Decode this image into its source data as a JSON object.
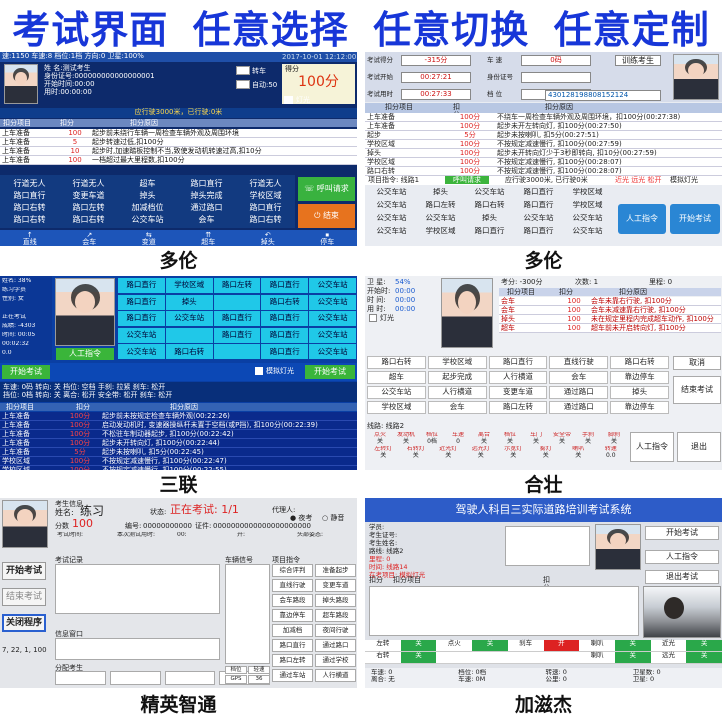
{
  "banner": {
    "parts": [
      "考试界面",
      "任意选择",
      "任意切换",
      "任意定制"
    ]
  },
  "captions": {
    "p1": "多伦",
    "p2": "多伦",
    "p3": "三联",
    "p4": "合壮",
    "p5": "精英智通",
    "p6": "加滋杰"
  },
  "p1": {
    "info": [
      "速:1150  车速:8   档位:1档   方向:0     卫星:100%",
      "姓    名:测试考生",
      "身份证号:000000000000000001",
      "开始时间:00:00",
      "用时:00:00:00"
    ],
    "date": "2017-10-01  12:12:00",
    "check1": "转车",
    "check2": "自动:50",
    "score_label": "得分",
    "score": "100分",
    "lamp": "灯光",
    "status": "应行驶3000米，已行驶:0米",
    "headers": [
      "扣分项目",
      "扣分",
      "扣分原因"
    ],
    "rows": [
      [
        "上车准备",
        "100",
        "起步前未绕行车辆一周检查车辆外观及周围环境"
      ],
      [
        "上车准备",
        "5",
        "起步转速过低,扣100分"
      ],
      [
        "上车准备",
        "10",
        "起步时,加速踏板控制不当,致使发动机转速过高,扣10分"
      ],
      [
        "上车准备",
        "100",
        "一档超过最大里程数,扣100分"
      ]
    ],
    "items": [
      [
        "行道无人",
        "行道无人",
        "超车",
        "路口直行",
        "行道无人"
      ],
      [
        "路口直行",
        "变更车道",
        "掉头",
        "掉头完成",
        "学校区域"
      ],
      [
        "路口右转",
        "路口左转",
        "加减档位",
        "通过路口",
        "路口直行"
      ],
      [
        "路口右转",
        "路口右转",
        "公交车站",
        "会车",
        "路口右转"
      ]
    ],
    "call_btn": "呼叫请求",
    "end_btn": "结束",
    "bottom": [
      "直线",
      "会车",
      "变道",
      "超车",
      "掉头",
      "停车"
    ]
  },
  "p2": {
    "fields": [
      [
        "考试得分",
        "-315分"
      ],
      [
        "车 速",
        "0码"
      ],
      [
        "考试开始",
        "00:27:21"
      ],
      [
        "身份证号",
        ""
      ],
      [
        "考试用时",
        "00:27:33"
      ],
      [
        "档 位",
        "空档"
      ]
    ],
    "name_btn": "训练考生",
    "id": "430128198808152124",
    "headers": [
      "扣分项目",
      "扣分",
      "扣分原因"
    ],
    "rows": [
      [
        "上车准备",
        "100分",
        "不绕车一周检查车辆外观及周围环境，扣100分(00:27:38)"
      ],
      [
        "上车准备",
        "100分",
        "起步未开左转向灯, 扣100分(00:27:50)"
      ],
      [
        "起步",
        "5分",
        "起步未按喇叭, 扣5分(00:27:51)"
      ],
      [
        "学校区域",
        "100分",
        "不按规定减速慢行, 扣100分(00:27:59)"
      ],
      [
        "掉头",
        "100分",
        "起步未开转向灯少于3秒即转向, 扣10分(00:27:59)"
      ],
      [
        "学校区域",
        "100分",
        "不按规定减速慢行, 扣100分(00:28:07)"
      ],
      [
        "路口右转",
        "100分",
        "不按规定减速慢行, 扣100分(00:28:07)"
      ]
    ],
    "route": "项目指令: 线路1",
    "call": "呼叫请求",
    "status": "应行驶3000米, 已行驶0米",
    "lights": [
      "近光",
      "远光",
      "松开",
      "模拟灯光"
    ],
    "items": [
      [
        "公交车站",
        "掉头",
        "公交车站",
        "路口直行",
        "学校区域"
      ],
      [
        "公交车站",
        "路口左转",
        "路口右转",
        "路口直行",
        "学校区域"
      ],
      [
        "公交车站",
        "公交车站",
        "掉头",
        "公交车站",
        "公交车站"
      ],
      [
        "公交车站",
        "学校区域",
        "路口直行",
        "路口直行",
        "公交车站"
      ]
    ],
    "btn1": "人工指令",
    "btn2": "开始考试"
  },
  "p3": {
    "info": [
      "姓名: 38%",
      "练习学员",
      "性别: 女",
      "",
      "正在考试",
      "成绩: -4303",
      "时间: 00:05",
      "00:02:32",
      "0.0"
    ],
    "grid": [
      [
        "路口直行",
        "学校区域",
        "路口左转",
        "路口直行",
        "公交车站"
      ],
      [
        "路口直行",
        "掉头",
        "",
        "路口右转",
        "公交车站"
      ],
      [
        "路口直行",
        "公交车站",
        "路口直行",
        "路口直行",
        "公交车站"
      ],
      [
        "公交车站",
        "",
        "路口直行",
        "路口直行",
        "公交车站"
      ],
      [
        "公交车站",
        "路口右转",
        "",
        "路口直行",
        "公交车站"
      ]
    ],
    "person_btn": "人工指令",
    "lamp": "模拟灯光",
    "start_btn": "开始考试",
    "gear": "车速: 0码       转向: 关        档位: 空档       手刹: 拉紧       刹车: 松开",
    "gear2": "挡位: 0档       转向: 关        离合: 松开       安全带: 松开    刹车: 松开",
    "headers": [
      "扣分项目",
      "扣分",
      "扣分原因"
    ],
    "rows": [
      [
        "上车准备",
        "100分",
        "起步前未按规定检查车辆外观(00:22:26)"
      ],
      [
        "上车准备",
        "100分",
        "启动发动机时, 变速器操纵杆未置于空档(或P挡), 扣100分(00:22:39)"
      ],
      [
        "上车准备",
        "100分",
        "不松驻车制动器起步, 扣100分(00:22:42)"
      ],
      [
        "上车准备",
        "100分",
        "起步未开转向灯, 扣100分(00:22:44)"
      ],
      [
        "上车准备",
        "5分",
        "起步未按喇叭, 扣5分(00:22:45)"
      ],
      [
        "学校区域",
        "100分",
        "不按规定减速慢行, 扣100分(00:22:47)"
      ],
      [
        "学校区域",
        "100分",
        "不按规定减速慢行, 扣100分(00:22:55)"
      ],
      [
        "路口右转",
        "100分",
        "转弯时, 未开或开转向灯少于3秒即转向, 扣10分(00:23:02)"
      ]
    ]
  },
  "p4": {
    "labels": [
      "卫  星:",
      "开始时:",
      "时  间:",
      "用  时:"
    ],
    "values": [
      "54%",
      "00:00",
      "00:00",
      "00:00"
    ],
    "top": [
      "考分: -300分",
      "次数: 1",
      "里程: 0"
    ],
    "lamp": "灯光",
    "headers": [
      "扣分项目",
      "扣分",
      "扣分原因"
    ],
    "rows": [
      [
        "会车",
        "100",
        "会车未靠右行驶, 扣100分"
      ],
      [
        "会车",
        "100",
        "会车未减速靠右行驶, 扣100分"
      ],
      [
        "掉头",
        "100",
        "未在规定里程内完成超车动作, 扣100分"
      ],
      [
        "超车",
        "100",
        "超车前未开启转向灯, 扣100分"
      ]
    ],
    "items": [
      [
        "路口右转",
        "学校区域",
        "路口直行",
        "直线行驶"
      ],
      [
        "超车",
        "起步完成",
        "人行横道",
        "会车"
      ],
      [
        "公交车站",
        "人行横道",
        "变更车道",
        "通过路口"
      ],
      [
        "学校区域",
        "会车",
        "路口左转",
        "通过路口"
      ]
    ],
    "right_items": [
      "路口右转",
      "靠边停车",
      "掉头",
      "靠边停车"
    ],
    "cancel": "取消",
    "end_exam": "结束考试",
    "route": "线路: 线路2",
    "sensor_h": [
      "点火",
      "发动机",
      "档位",
      "车速",
      "离合",
      "档位",
      "车门",
      "安全带",
      "手刹",
      "脚刹"
    ],
    "sensor_v": [
      "关",
      "关",
      "0档",
      "0",
      "关",
      "关",
      "关",
      "关",
      "关",
      "关"
    ],
    "sensor_h2": [
      "左转灯",
      "右转灯",
      "近光灯",
      "远光灯",
      "示宽灯",
      "雾灯",
      "喇叭",
      "转速"
    ],
    "sensor_v2": [
      "关",
      "关",
      "关",
      "关",
      "关",
      "关",
      "关",
      "0.0"
    ],
    "btn_cmd": "人工指令",
    "btn_exit": "退出"
  },
  "p5": {
    "tab": "考生信息",
    "name_label": "姓名:",
    "name": "练习",
    "state_label": "状态:",
    "state": "正在考试: 1/1",
    "agent_label": "代理人:",
    "score_label": "分数",
    "score": "100",
    "num_label": "编号:",
    "num": "00000000000",
    "cert_label": "证件:",
    "cert": "0000000000000000000000",
    "day": "夜考",
    "quiet": "静音",
    "sub": [
      "考试时间:",
      "本次测试用时:",
      "00:",
      "开:",
      "头部姿态:"
    ],
    "left_btns": [
      "开始考试",
      "结束考试",
      "关闭程序"
    ],
    "ip": "7, 22, 1, 100",
    "record": "考试记录",
    "car_label": "车辆信号",
    "window": "信息窗口",
    "assign": "分配考生",
    "items_label": "项目指令",
    "items": [
      [
        "综合评判",
        "准备起步"
      ],
      [
        "直线行驶",
        "变更车道"
      ],
      [
        "会车路段",
        "掉头路段"
      ],
      [
        "靠边停车",
        "超车路段"
      ],
      [
        "加减档",
        "夜间行驶"
      ],
      [
        "路口直行",
        "通过路口"
      ],
      [
        "路口左转",
        "通过学校"
      ],
      [
        "通过车站",
        "人行横道"
      ]
    ],
    "status_btns": [
      "档位",
      "轻速",
      "GPS",
      "36"
    ]
  },
  "p6": {
    "title": "驾驶人科目三实际道路培训考试系统",
    "fields": [
      "学员:",
      "考生证号:",
      "考生姓名:",
      "路线: 线路2",
      "里程: 0",
      "时间: 线路14",
      "在考项目: 模拟灯光"
    ],
    "btns": [
      "开始考试",
      "人工指令",
      "退出考试"
    ],
    "tabs": [
      "扣分",
      "扣分项目",
      "扣分原因"
    ],
    "sig1": [
      "左转",
      "点火",
      "刹车",
      "喇叭",
      "近光"
    ],
    "sig1v": [
      "关",
      "关",
      "开",
      "关",
      "关"
    ],
    "sig2": [
      "右转",
      "",
      "",
      "喇叭",
      "远光"
    ],
    "sig2v": [
      "关",
      "",
      "",
      "关",
      "关"
    ],
    "foot": [
      "车速: 0",
      "档位: 0档",
      "转速: 0",
      "卫星数: 0"
    ],
    "foot2": [
      "离合: 无",
      "车速: 0M",
      "公里: 0",
      "卫星: 0"
    ]
  }
}
